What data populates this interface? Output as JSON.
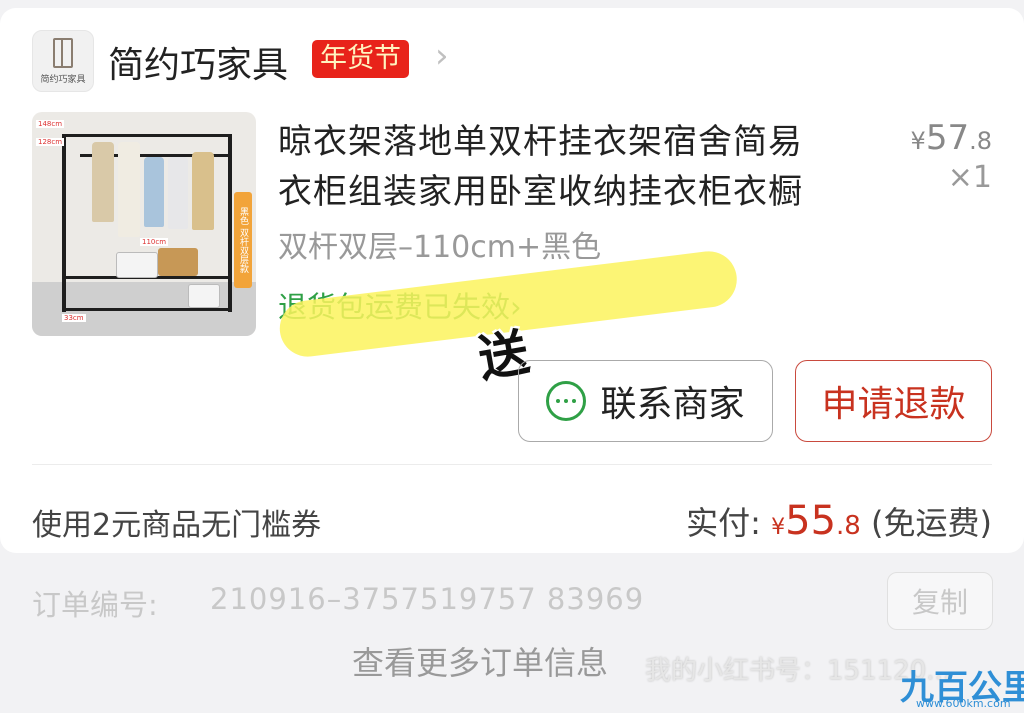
{
  "shop": {
    "logo_text": "简约巧家具",
    "name": "简约巧家具",
    "badge": "年货节",
    "chevron": "›"
  },
  "product": {
    "title_line1": "晾衣架落地单双杆挂衣架宿舍简易",
    "title_line2": "衣柜组装家用卧室收纳挂衣柜衣橱",
    "price_symbol": "¥",
    "price_int": "57",
    "price_dec": ".8",
    "quantity": "×1",
    "spec": "双杆双层–110cm+黑色",
    "return_notice": "退货包运费已失效",
    "return_chevron": "›",
    "image_labels": {
      "dim_height1": "148cm",
      "dim_height2": "128cm",
      "dim_width": "110cm",
      "dim_depth": "33cm",
      "tag": "黑色 双杆双层款"
    }
  },
  "annotation": {
    "sticker_text": "送",
    "highlight_color": "#fbf35d"
  },
  "actions": {
    "contact_label": "联系商家",
    "refund_label": "申请退款"
  },
  "summary": {
    "coupon_text": "使用2元商品无门槛券",
    "paid_label": "实付:",
    "paid_symbol": "¥",
    "paid_int": "55",
    "paid_dec": ".8",
    "shipping_note": "(免运费)"
  },
  "order": {
    "number_label": "订单编号:",
    "number": "210916–3757519757 83969",
    "copy_label": "复制",
    "more_info_label": "查看更多订单信息"
  },
  "overlay": {
    "watermark": "我的小红书号：151120...",
    "site_logo": "九百公里",
    "site_url": "www.600km.com"
  },
  "colors": {
    "accent_red": "#c8321f",
    "badge_red": "#e8231a",
    "green": "#2fa046",
    "site_blue": "#2f8fd6"
  },
  "icons": {
    "chat": "chat-bubble-icon",
    "chevron_right": "chevron-right-icon",
    "chevron_down": "chevron-down-icon"
  }
}
